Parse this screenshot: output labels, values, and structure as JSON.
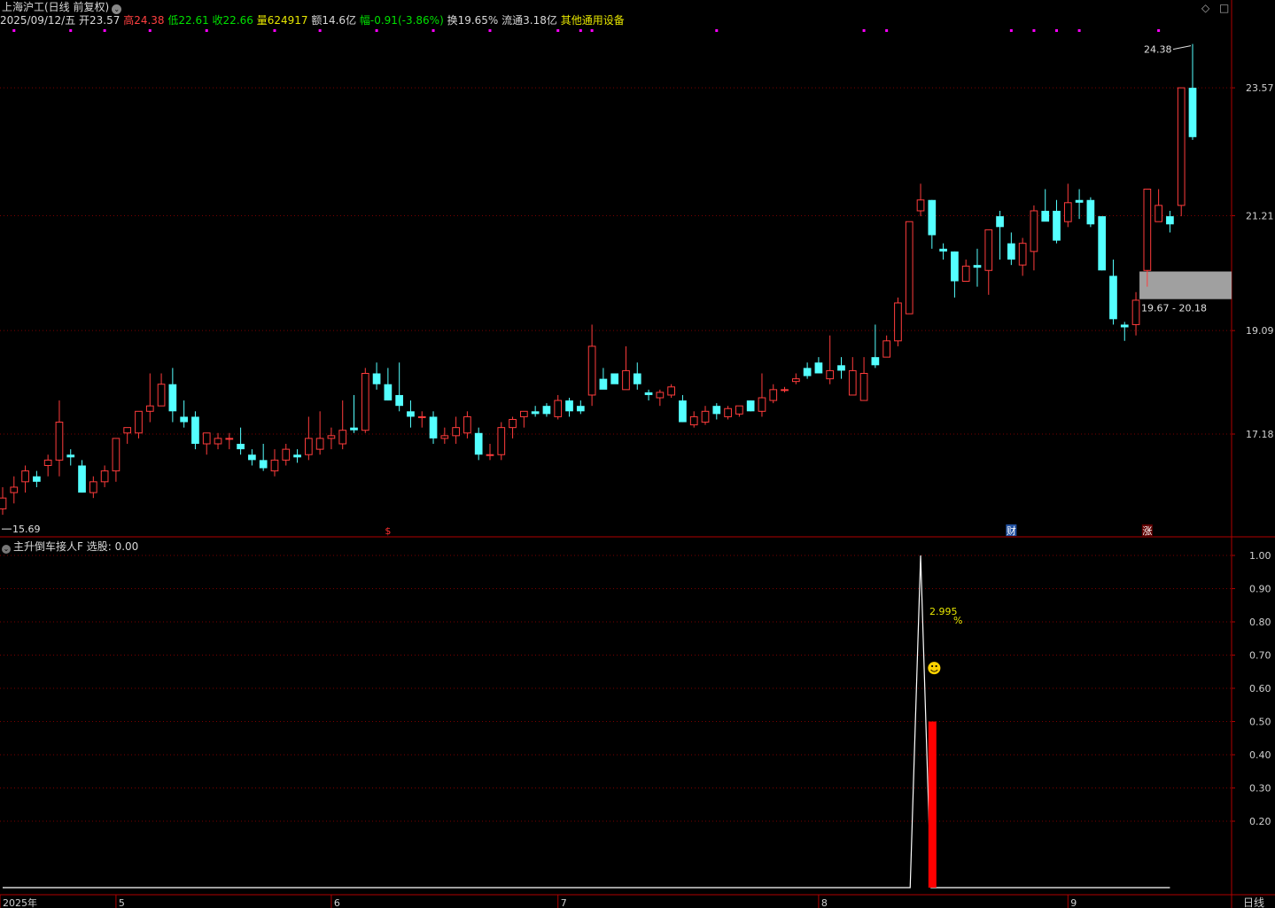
{
  "header": {
    "title": "上海沪工(日线 前复权)",
    "line2": [
      {
        "text": "2025/09/12/五",
        "color": "#d8d8d8"
      },
      {
        "text": " 开23.57",
        "color": "#d8d8d8"
      },
      {
        "text": " 高24.38",
        "color": "#ff4040"
      },
      {
        "text": " 低22.61",
        "color": "#00e000"
      },
      {
        "text": " 收22.66",
        "color": "#00e000"
      },
      {
        "text": " 量624917",
        "color": "#e6e600"
      },
      {
        "text": " 额14.6亿",
        "color": "#d8d8d8"
      },
      {
        "text": " 幅-0.91(-3.86%)",
        "color": "#00e000"
      },
      {
        "text": " 换19.65%",
        "color": "#d8d8d8"
      },
      {
        "text": " 流通3.18亿",
        "color": "#d8d8d8"
      },
      {
        "text": " 其他通用设备",
        "color": "#e6e600"
      }
    ]
  },
  "controls": {
    "diamond": "◇",
    "square": "□"
  },
  "indicator": {
    "name": "主升倒车接人F",
    "label": "选股: 0.00"
  },
  "colors": {
    "up": "#ff3c3c",
    "down": "#54ffff",
    "grid": "#7a0000",
    "axis": "#b00000",
    "zone": "#a0a0a0",
    "signal": "#ff0000",
    "magenta": "#ff00ff"
  },
  "chart_data": [
    {
      "type": "candlestick",
      "price_axis_ticks": [
        23.57,
        21.21,
        19.09,
        17.18
      ],
      "ylim": [
        15.3,
        24.7
      ],
      "x_ticks": [
        "2025年",
        "5",
        "6",
        "7",
        "8",
        "9"
      ],
      "x_tick_candle_index": [
        0,
        10,
        29,
        49,
        72,
        94
      ],
      "annotations": {
        "high": "24.38",
        "low": "15.69",
        "zone": "19.67 - 20.18",
        "zone_range": [
          19.67,
          20.18
        ]
      },
      "markers": [
        {
          "label": "$",
          "index": 34
        },
        {
          "label": "财",
          "index": 89
        },
        {
          "label": "涨",
          "index": 101
        }
      ],
      "magenta_dots": [
        1,
        6,
        9,
        13,
        18,
        24,
        28,
        33,
        38,
        43,
        49,
        51,
        52,
        63,
        76,
        78,
        89,
        91,
        93,
        95,
        102
      ],
      "candles": [
        [
          15.8,
          16.2,
          15.69,
          16.0
        ],
        [
          16.1,
          16.4,
          15.9,
          16.2
        ],
        [
          16.3,
          16.6,
          16.1,
          16.5
        ],
        [
          16.4,
          16.5,
          16.2,
          16.3
        ],
        [
          16.6,
          16.8,
          16.4,
          16.7
        ],
        [
          16.7,
          17.8,
          16.4,
          17.4
        ],
        [
          16.8,
          16.9,
          16.6,
          16.75
        ],
        [
          16.6,
          16.7,
          16.1,
          16.1
        ],
        [
          16.1,
          16.4,
          16.0,
          16.3
        ],
        [
          16.3,
          16.6,
          16.2,
          16.5
        ],
        [
          16.5,
          17.0,
          16.3,
          17.1
        ],
        [
          17.2,
          17.2,
          17.0,
          17.3
        ],
        [
          17.2,
          17.6,
          17.1,
          17.6
        ],
        [
          17.6,
          18.3,
          17.4,
          17.7
        ],
        [
          17.7,
          18.3,
          17.7,
          18.1
        ],
        [
          18.1,
          18.4,
          17.4,
          17.6
        ],
        [
          17.5,
          17.8,
          17.3,
          17.4
        ],
        [
          17.5,
          17.6,
          16.9,
          17.0
        ],
        [
          17.0,
          17.2,
          16.8,
          17.2
        ],
        [
          17.0,
          17.2,
          16.9,
          17.1
        ],
        [
          17.1,
          17.2,
          16.9,
          17.1
        ],
        [
          17.0,
          17.3,
          16.8,
          16.9
        ],
        [
          16.8,
          16.9,
          16.6,
          16.7
        ],
        [
          16.7,
          17.0,
          16.5,
          16.55
        ],
        [
          16.5,
          16.9,
          16.4,
          16.7
        ],
        [
          16.7,
          17.0,
          16.6,
          16.9
        ],
        [
          16.8,
          16.9,
          16.65,
          16.75
        ],
        [
          16.8,
          17.5,
          16.7,
          17.1
        ],
        [
          16.9,
          17.6,
          16.8,
          17.1
        ],
        [
          17.1,
          17.3,
          16.9,
          17.15
        ],
        [
          17.0,
          17.8,
          16.9,
          17.25
        ],
        [
          17.3,
          17.9,
          17.2,
          17.25
        ],
        [
          17.25,
          18.4,
          17.2,
          18.3
        ],
        [
          18.3,
          18.5,
          18.0,
          18.1
        ],
        [
          18.1,
          18.4,
          17.8,
          17.8
        ],
        [
          17.9,
          18.5,
          17.6,
          17.7
        ],
        [
          17.6,
          17.8,
          17.3,
          17.5
        ],
        [
          17.5,
          17.6,
          17.3,
          17.5
        ],
        [
          17.5,
          17.6,
          17.0,
          17.1
        ],
        [
          17.1,
          17.3,
          17.0,
          17.15
        ],
        [
          17.15,
          17.5,
          17.0,
          17.3
        ],
        [
          17.2,
          17.6,
          17.1,
          17.5
        ],
        [
          17.2,
          17.3,
          16.7,
          16.8
        ],
        [
          16.8,
          17.0,
          16.7,
          16.8
        ],
        [
          16.8,
          17.4,
          16.7,
          17.3
        ],
        [
          17.3,
          17.5,
          17.1,
          17.45
        ],
        [
          17.5,
          17.6,
          17.3,
          17.6
        ],
        [
          17.6,
          17.7,
          17.5,
          17.55
        ],
        [
          17.7,
          17.75,
          17.5,
          17.55
        ],
        [
          17.5,
          17.9,
          17.45,
          17.8
        ],
        [
          17.8,
          17.85,
          17.5,
          17.6
        ],
        [
          17.7,
          17.8,
          17.55,
          17.6
        ],
        [
          17.9,
          19.2,
          17.7,
          18.8
        ],
        [
          18.2,
          18.4,
          18.2,
          18.0
        ],
        [
          18.3,
          18.25,
          18.2,
          18.1
        ],
        [
          18.0,
          18.8,
          18.1,
          18.35
        ],
        [
          18.3,
          18.5,
          18.0,
          18.1
        ],
        [
          17.95,
          18.0,
          17.8,
          17.9
        ],
        [
          17.85,
          18.0,
          17.7,
          17.95
        ],
        [
          17.9,
          18.1,
          17.85,
          18.05
        ],
        [
          17.8,
          17.9,
          17.4,
          17.4
        ],
        [
          17.35,
          17.6,
          17.3,
          17.5
        ],
        [
          17.4,
          17.7,
          17.35,
          17.6
        ],
        [
          17.7,
          17.75,
          17.45,
          17.55
        ],
        [
          17.5,
          17.7,
          17.45,
          17.65
        ],
        [
          17.55,
          17.7,
          17.5,
          17.7
        ],
        [
          17.8,
          17.8,
          17.6,
          17.6
        ],
        [
          17.6,
          18.3,
          17.5,
          17.85
        ],
        [
          17.8,
          18.1,
          17.75,
          18.0
        ],
        [
          18.0,
          18.05,
          17.95,
          18.0
        ],
        [
          18.15,
          18.3,
          18.1,
          18.2
        ],
        [
          18.4,
          18.5,
          18.2,
          18.25
        ],
        [
          18.5,
          18.6,
          18.4,
          18.3
        ],
        [
          18.2,
          19.0,
          18.1,
          18.35
        ],
        [
          18.45,
          18.6,
          18.2,
          18.35
        ],
        [
          17.9,
          18.6,
          17.9,
          18.35
        ],
        [
          17.8,
          18.6,
          17.8,
          18.3
        ],
        [
          18.6,
          19.2,
          18.4,
          18.45
        ],
        [
          18.6,
          19.0,
          18.65,
          18.9
        ],
        [
          18.9,
          19.7,
          18.8,
          19.6
        ],
        [
          19.4,
          21.1,
          19.4,
          21.1
        ],
        [
          21.3,
          21.8,
          21.2,
          21.5
        ],
        [
          21.5,
          21.5,
          20.6,
          20.85
        ],
        [
          20.6,
          20.7,
          20.4,
          20.55
        ],
        [
          20.55,
          20.55,
          19.7,
          20.0
        ],
        [
          20.0,
          20.4,
          20.0,
          20.28
        ],
        [
          20.3,
          20.6,
          19.9,
          20.25
        ],
        [
          20.2,
          20.75,
          19.75,
          20.95
        ],
        [
          21.2,
          21.3,
          20.4,
          21.0
        ],
        [
          20.7,
          20.9,
          20.3,
          20.4
        ],
        [
          20.3,
          20.8,
          20.1,
          20.7
        ],
        [
          20.55,
          21.4,
          20.2,
          21.3
        ],
        [
          21.3,
          21.7,
          21.25,
          21.1
        ],
        [
          21.3,
          21.5,
          20.7,
          20.75
        ],
        [
          21.1,
          21.8,
          21.0,
          21.45
        ],
        [
          21.5,
          21.7,
          21.15,
          21.45
        ],
        [
          21.5,
          21.55,
          21.0,
          21.05
        ],
        [
          21.2,
          21.1,
          20.2,
          20.2
        ],
        [
          20.1,
          20.4,
          19.2,
          19.3
        ],
        [
          19.2,
          19.25,
          18.9,
          19.15
        ],
        [
          19.2,
          19.8,
          19.0,
          19.65
        ],
        [
          20.2,
          21.3,
          19.9,
          21.7
        ],
        [
          21.1,
          21.7,
          21.2,
          21.4
        ],
        [
          21.2,
          21.3,
          20.9,
          21.05
        ],
        [
          21.4,
          22.2,
          21.2,
          23.57
        ],
        [
          23.57,
          24.38,
          22.61,
          22.66
        ]
      ]
    },
    {
      "type": "line",
      "name": "主升倒车接人F",
      "y_ticks": [
        1.0,
        0.9,
        0.8,
        0.7,
        0.6,
        0.5,
        0.4,
        0.3,
        0.2
      ],
      "ylim": [
        0,
        1.0
      ],
      "series_start_index": 0,
      "series_end_index": 103,
      "peak_index": 81,
      "peak_value": 1.0,
      "signal_bar": {
        "index": 82,
        "value": 0.5
      },
      "annotation_value": "2.995",
      "annotation_unit": "%",
      "smiley": "☻"
    }
  ]
}
